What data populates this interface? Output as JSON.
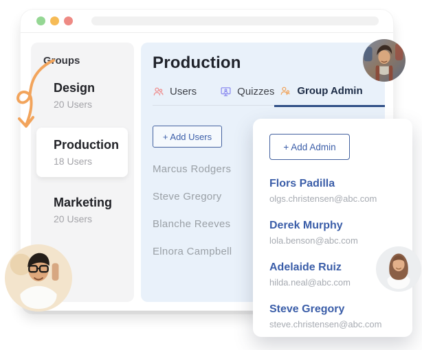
{
  "browser": {
    "traffic_lights": [
      "green-dot",
      "yellow-dot",
      "red-dot"
    ],
    "url_value": ""
  },
  "sidebar": {
    "title": "Groups",
    "groups": [
      {
        "name": "Design",
        "meta": "20 Users",
        "active": false
      },
      {
        "name": "Production",
        "meta": "18 Users",
        "active": true
      },
      {
        "name": "Marketing",
        "meta": "20 Users",
        "active": false
      }
    ]
  },
  "main": {
    "title": "Production",
    "tabs": [
      {
        "label": "Users",
        "icon": "users-icon",
        "icon_color": "#ef8f8f",
        "active": false
      },
      {
        "label": "Quizzes",
        "icon": "quizzes-icon",
        "icon_color": "#8b8bf0",
        "active": false
      },
      {
        "label": "Group Admin",
        "icon": "group-admin-icon",
        "icon_color": "#f0a660",
        "active": true
      }
    ],
    "add_users_button": "+ Add Users",
    "users": [
      "Marcus Rodgers",
      "Steve Gregory",
      "Blanche Reeves",
      "Elnora Campbell"
    ]
  },
  "admin_panel": {
    "add_admin_button": "+ Add Admin",
    "admins": [
      {
        "name": "Flors Padilla",
        "email": "olgs.christensen@abc.com"
      },
      {
        "name": "Derek Murphy",
        "email": "lola.benson@abc.com"
      },
      {
        "name": "Adelaide Ruiz",
        "email": "hilda.neal@abc.com"
      },
      {
        "name": "Steve Gregory",
        "email": "steve.christensen@abc.com"
      }
    ]
  },
  "colors": {
    "accent_blue": "#3a5da8",
    "tab_underline": "#2d4d85",
    "main_panel_bg": "#e9f1fa",
    "sidebar_bg": "#f4f4f5",
    "arrow_orange": "#f2a45c",
    "traffic_green": "#95d794",
    "traffic_yellow": "#f6bb56",
    "traffic_red": "#ee8a84",
    "muted_text": "#9aa0a6"
  }
}
